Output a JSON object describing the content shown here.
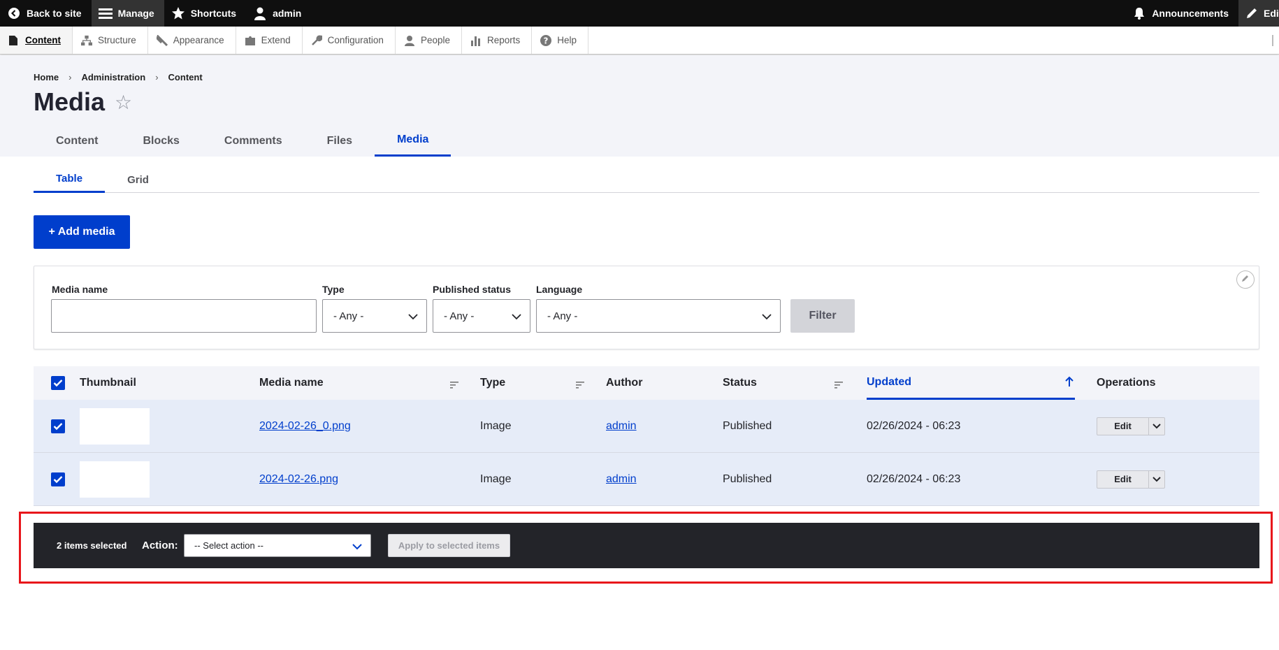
{
  "toolbar": {
    "back_to_site": "Back to site",
    "manage": "Manage",
    "shortcuts": "Shortcuts",
    "user": "admin",
    "announcements": "Announcements",
    "edit": "Edit"
  },
  "tray": {
    "items": [
      "Content",
      "Structure",
      "Appearance",
      "Extend",
      "Configuration",
      "People",
      "Reports",
      "Help"
    ]
  },
  "breadcrumb": [
    "Home",
    "Administration",
    "Content"
  ],
  "page_title": "Media",
  "primary_tabs": [
    "Content",
    "Blocks",
    "Comments",
    "Files",
    "Media"
  ],
  "secondary_tabs": [
    "Table",
    "Grid"
  ],
  "add_button": "+ Add media",
  "filters": {
    "media_name_label": "Media name",
    "media_name_value": "",
    "type_label": "Type",
    "type_value": "- Any -",
    "status_label": "Published status",
    "status_value": "- Any -",
    "language_label": "Language",
    "language_value": "- Any -",
    "filter_button": "Filter"
  },
  "table": {
    "headers": {
      "thumbnail": "Thumbnail",
      "media_name": "Media name",
      "type": "Type",
      "author": "Author",
      "status": "Status",
      "updated": "Updated",
      "operations": "Operations"
    },
    "rows": [
      {
        "name": "2024-02-26_0.png",
        "type": "Image",
        "author": "admin",
        "status": "Published",
        "updated": "02/26/2024 - 06:23",
        "op": "Edit"
      },
      {
        "name": "2024-02-26.png",
        "type": "Image",
        "author": "admin",
        "status": "Published",
        "updated": "02/26/2024 - 06:23",
        "op": "Edit"
      }
    ]
  },
  "bulk": {
    "count": "2 items selected",
    "action_label": "Action:",
    "action_value": "-- Select action --",
    "apply": "Apply to selected items"
  },
  "colors": {
    "accent": "#003ecc",
    "highlight": "#e8161b",
    "bulk_bar": "#232429"
  }
}
